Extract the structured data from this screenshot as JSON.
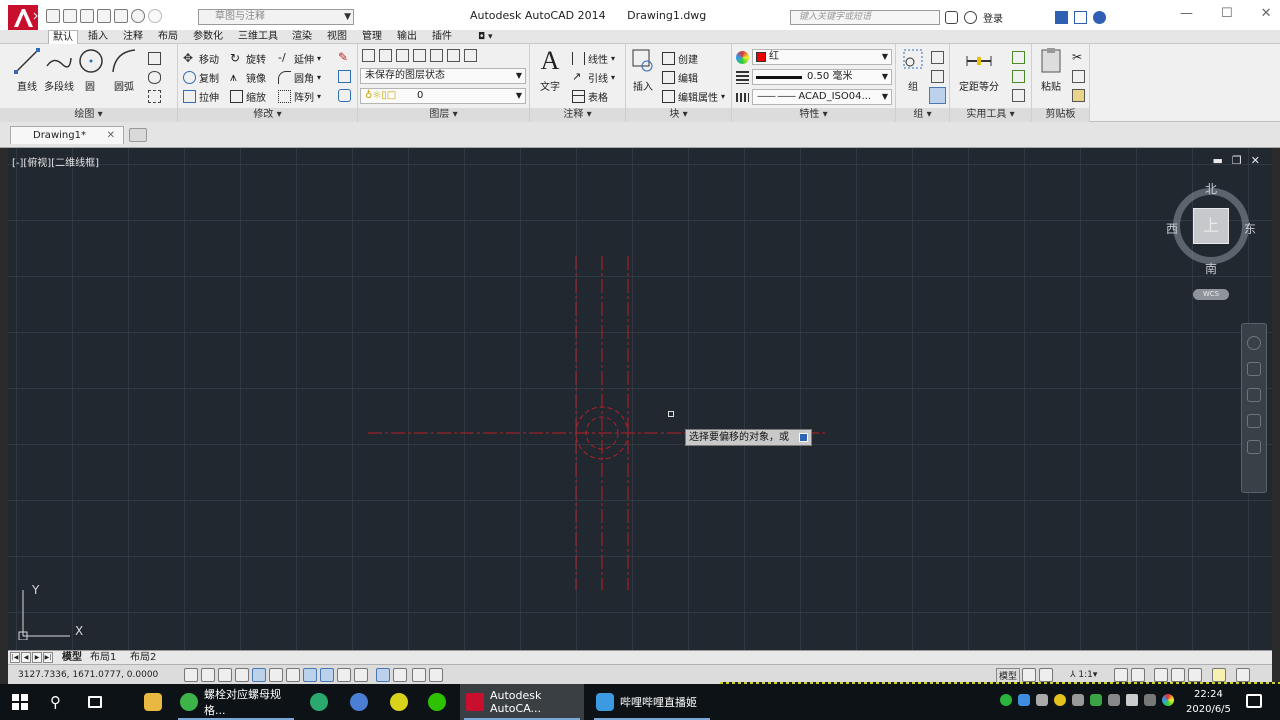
{
  "titlebar": {
    "workspace": "草图与注释",
    "app_title": "Autodesk AutoCAD 2014",
    "doc_title": "Drawing1.dwg",
    "search_placeholder": "键入关键字或短语",
    "login": "登录"
  },
  "ribbon_tabs": [
    "默认",
    "插入",
    "注释",
    "布局",
    "参数化",
    "三维工具",
    "渲染",
    "视图",
    "管理",
    "输出",
    "插件"
  ],
  "panels": {
    "draw": {
      "title": "绘图",
      "line": "直线",
      "polyline": "多段线",
      "circle": "圆",
      "arc": "圆弧"
    },
    "modify": {
      "title": "修改",
      "move": "移动",
      "rotate": "旋转",
      "extend": "延伸",
      "copy": "复制",
      "mirror": "镜像",
      "fillet": "圆角",
      "stretch": "拉伸",
      "scale": "缩放",
      "array": "阵列"
    },
    "layer": {
      "title": "图层",
      "state": "未保存的图层状态",
      "current": "0"
    },
    "annotation": {
      "title": "注释",
      "text": "文字",
      "linear": "线性",
      "leader": "引线",
      "table": "表格"
    },
    "block": {
      "title": "块",
      "insert": "插入",
      "create": "创建",
      "edit": "编辑",
      "edit_attr": "编辑属性"
    },
    "properties": {
      "title": "特性",
      "color": "红",
      "lineweight": "0.50 毫米",
      "linetype": "ACAD_ISO04..."
    },
    "group": {
      "title": "组",
      "group": "组"
    },
    "utilities": {
      "title": "实用工具",
      "measure": "定距等分"
    },
    "clipboard": {
      "title": "剪贴板",
      "paste": "粘贴"
    }
  },
  "doc_tab": {
    "label": "Drawing1*"
  },
  "canvas": {
    "view_label": "[-][俯视][二维线框]",
    "viewcube": {
      "top": "上",
      "north": "北",
      "south": "南",
      "east": "东",
      "west": "西",
      "wcs": "WCS"
    },
    "tooltip": "选择要偏移的对象，或",
    "ucs": {
      "x": "X",
      "y": "Y"
    }
  },
  "layout_tabs": [
    "模型",
    "布局1",
    "布局2"
  ],
  "status": {
    "coords": "3127.7336, 1671.0777, 0.0000",
    "model": "模型",
    "scale": "1:1"
  },
  "taskbar": {
    "items": [
      "螺栓对应螺母规格...",
      "Autodesk AutoCA...",
      "哔哩哔哩直播姬"
    ],
    "time": "22:24",
    "date": "2020/6/5"
  },
  "colors": {
    "accent_red": "#c8102e",
    "drawing_red": "#b51f28",
    "canvas_bg": "#212830"
  }
}
